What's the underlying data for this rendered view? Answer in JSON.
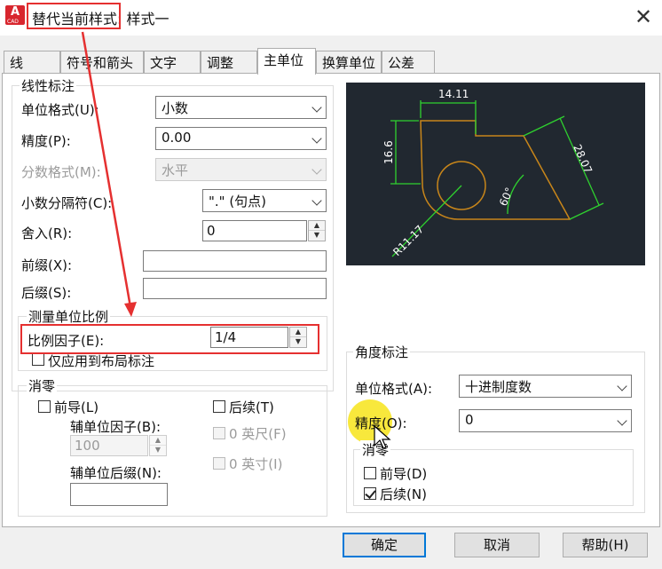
{
  "window": {
    "title": "替代当前样式: 样式一",
    "icon_text": "A",
    "icon_sub": "CAD"
  },
  "tabs": [
    "线",
    "符号和箭头",
    "文字",
    "调整",
    "主单位",
    "换算单位",
    "公差"
  ],
  "linear": {
    "title": "线性标注",
    "unit_format": {
      "label": "单位格式(U):",
      "value": "小数"
    },
    "precision": {
      "label": "精度(P):",
      "value": "0.00"
    },
    "fraction_format": {
      "label": "分数格式(M):",
      "value": "水平"
    },
    "decimal_separator": {
      "label": "小数分隔符(C):",
      "value": "\".\" (句点)"
    },
    "round_off": {
      "label": "舍入(R):",
      "value": "0"
    },
    "prefix": {
      "label": "前缀(X):",
      "value": ""
    },
    "suffix": {
      "label": "后缀(S):",
      "value": ""
    }
  },
  "scale": {
    "title": "测量单位比例",
    "factor_label": "比例因子(E):",
    "factor_value": "1/4",
    "layout_only_label": "仅应用到布局标注"
  },
  "zero_suppression": {
    "title": "消零",
    "leading_label": "前导(L)",
    "trailing_label": "后续(T)",
    "sub_unit_factor_label": "辅单位因子(B):",
    "sub_unit_factor_value": "100",
    "feet_label": "0 英尺(F)",
    "inches_label": "0 英寸(I)",
    "sub_unit_suffix_label": "辅单位后缀(N):",
    "sub_unit_suffix_value": ""
  },
  "preview": {
    "dim_top": "14.11",
    "dim_left": "16.6",
    "dim_right": "28.07",
    "dim_angle": "60°",
    "dim_radius": "R11.17",
    "colors": {
      "background": "#212830",
      "geometry": "#c8861a",
      "dimension": "#2fd12f",
      "text": "#ffffff"
    }
  },
  "angular": {
    "title": "角度标注",
    "unit_format": {
      "label": "单位格式(A):",
      "value": "十进制度数"
    },
    "precision": {
      "label": "精度(O):",
      "value": "0"
    },
    "zero_title": "消零",
    "leading_label": "前导(D)",
    "trailing_label": "后续(N)",
    "trailing_checked": true
  },
  "buttons": {
    "ok": "确定",
    "cancel": "取消",
    "help": "帮助(H)"
  },
  "annotation_colors": {
    "highlight": "#e53030",
    "cursor_spot": "#f7e41a"
  }
}
